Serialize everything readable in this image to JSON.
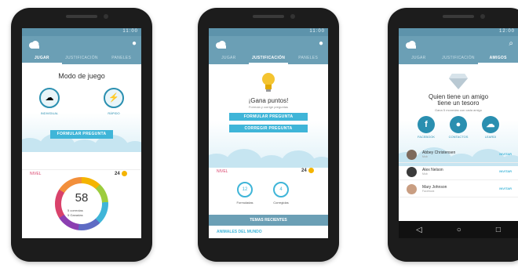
{
  "status": {
    "time": "11:00",
    "time2": "12:00"
  },
  "phone1": {
    "tabs": [
      "JUGAR",
      "JUSTIFICACIÓN",
      "PANELES"
    ],
    "title": "Modo de juego",
    "mode_left": "INDIVIDUAL",
    "mode_right": "RÁPIDO",
    "button": "FORMULAR PREGUNTA",
    "level": "NIVEL",
    "points": "24",
    "score": "58",
    "legend1": "5 correctas",
    "legend2": "5 Ganadas"
  },
  "phone2": {
    "tabs": [
      "JUGAR",
      "JUSTIFICACIÓN",
      "PANELES"
    ],
    "title": "¡Gana puntos!",
    "subtitle": "Formula y corrige preguntas",
    "button1": "FORMULAR PREGUNTA",
    "button2": "CORREGIR PREGUNTA",
    "level": "NIVEL",
    "points": "24",
    "stat1_value": "12",
    "stat1_label": "Formuladas",
    "stat2_value": "4",
    "stat2_label": "Corregidas",
    "recent": "TEMAS RECIENTES",
    "topic": "ANIMALES DEL MUNDO"
  },
  "phone3": {
    "tabs": [
      "JUGAR",
      "JUSTIFICACIÓN",
      "AMIGOS"
    ],
    "title_line1": "Quien tiene un amigo",
    "title_line2": "tiene un tesoro",
    "subtitle": "Gana 5 monedas con cada amigo",
    "social": [
      "FACEBOOK",
      "CONTACTOS",
      "LEARDI"
    ],
    "friends": [
      {
        "name": "Abbey Christensen",
        "sub": "Mob",
        "action": "INVITAR"
      },
      {
        "name": "Alex Nelson",
        "sub": "Mob",
        "action": "INVITAR"
      },
      {
        "name": "Mary Johnson",
        "sub": "Facebook",
        "action": "INVITAR"
      }
    ]
  },
  "colors": {
    "accent": "#3fb5d8",
    "appbar": "#6b9fb5",
    "level": "#d9426b",
    "coin": "#f4b400"
  }
}
